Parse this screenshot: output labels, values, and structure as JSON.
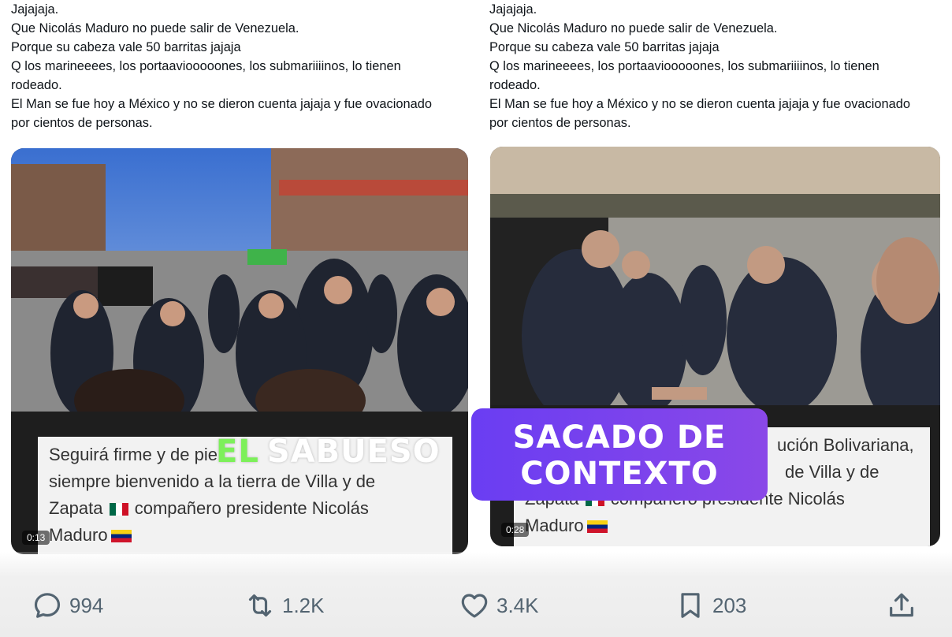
{
  "post_left": {
    "lines": [
      "Jajajaja.",
      "Que Nicolás Maduro no puede salir de Venezuela.",
      "Porque su cabeza vale 50 barritas jajaja",
      "Q los marineeees, los portaaviooooones, los submariiiinos, lo tienen",
      "rodeado.",
      "El Man se fue hoy a México y no se dieron cuenta jajaja y fue ovacionado",
      "por cientos de personas."
    ],
    "caption_lines": [
      "Seguirá firme y de pie",
      "siempre bienvenido a la tierra de Villa y de",
      "Zapata",
      "compañero presidente Nicolás",
      "Maduro"
    ],
    "video_time": "0:13"
  },
  "post_right": {
    "lines": [
      "Jajajaja.",
      "Que Nicolás Maduro no puede salir de Venezuela.",
      "Porque su cabeza vale 50 barritas jajaja",
      "Q los marineeees, los portaaviooooones, los submariiiinos, lo tienen",
      "rodeado.",
      "El Man se fue hoy a México y no se dieron cuenta jajaja y fue ovacionado",
      "por cientos de personas."
    ],
    "caption_lines": [
      "ución Bolivariana,",
      "de Villa y de",
      "Zapata",
      "compañero presidente Nicolás",
      "Maduro"
    ],
    "video_time": "0:28"
  },
  "watermark": {
    "prefix": "EL",
    "name": "SABUESO"
  },
  "stamp": {
    "line1": "SACADO DE",
    "line2": "CONTEXTO",
    "color": "#7b43ef"
  },
  "actions": {
    "replies": "994",
    "retweets": "1.2K",
    "likes": "3.4K",
    "bookmarks": "203"
  },
  "icons": [
    "reply-icon",
    "retweet-icon",
    "like-icon",
    "bookmark-icon",
    "share-icon"
  ]
}
